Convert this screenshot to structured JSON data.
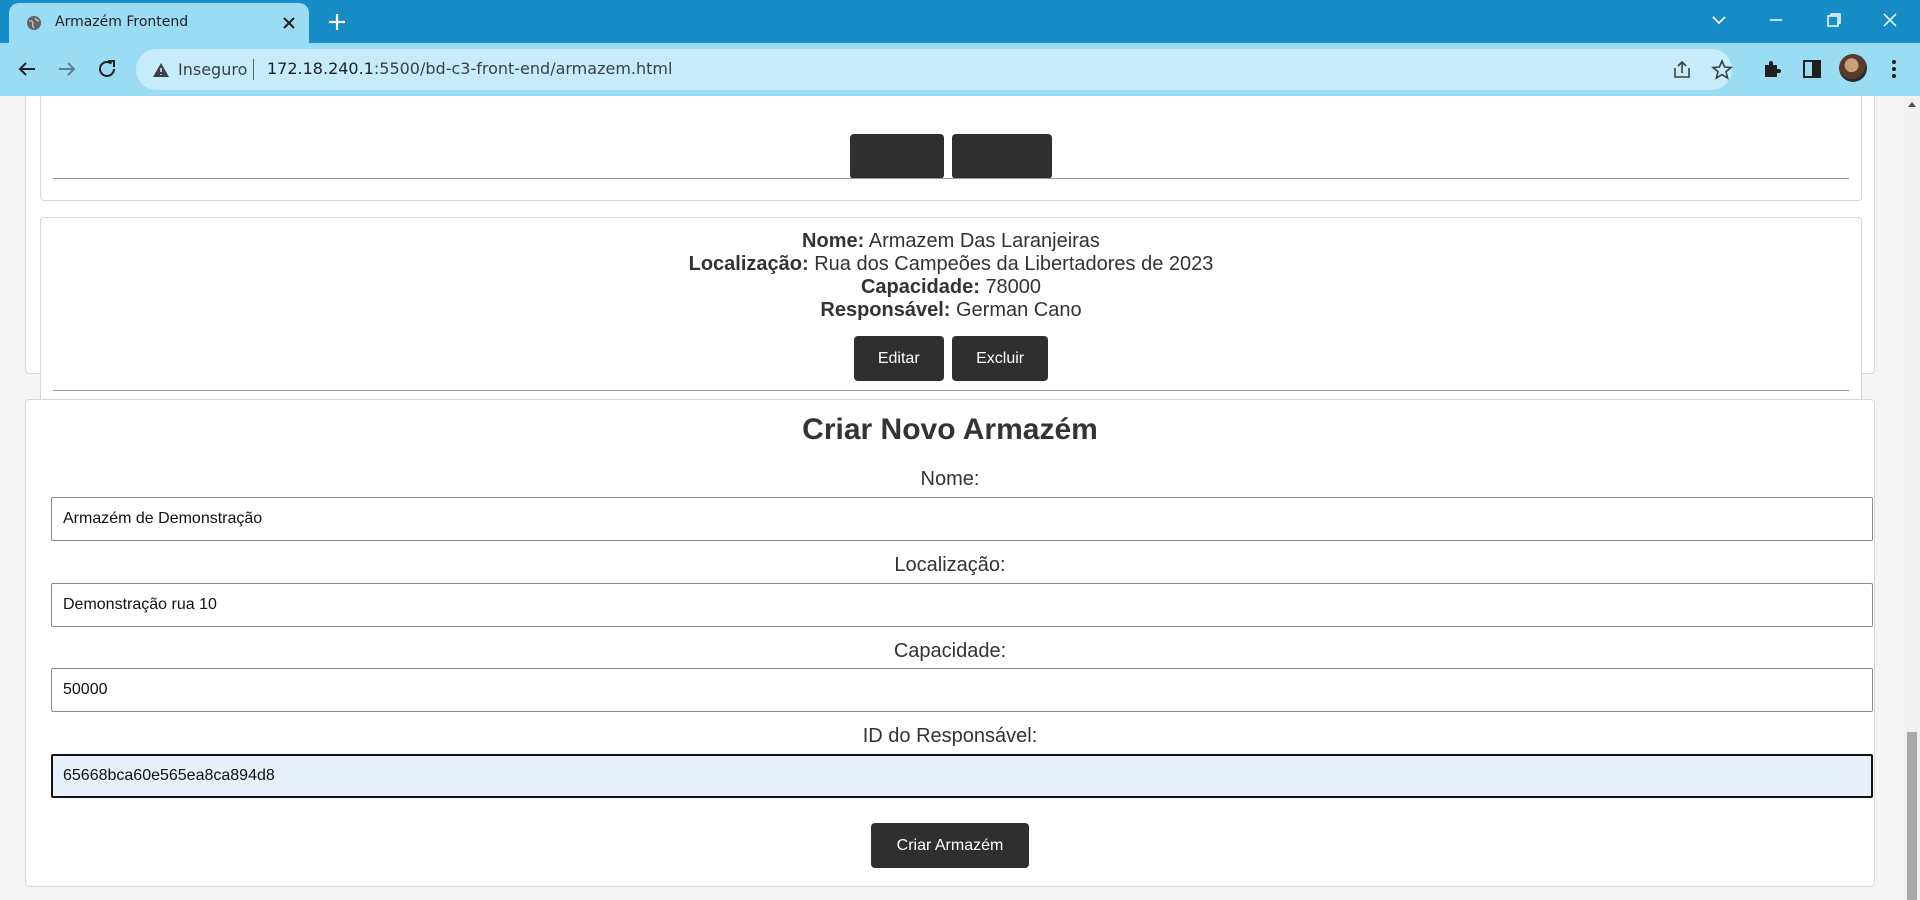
{
  "browser": {
    "tab_title": "Armazém Frontend",
    "security_label": "Inseguro",
    "url_host": "172.18.240.1",
    "url_path": ":5500/bd-c3-front-end/armazem.html"
  },
  "warehouses": [
    {
      "name_label": "Nome:",
      "name": "Armazem Das Laranjeiras",
      "location_label": "Localização:",
      "location": "Rua dos Campeões da Libertadores de 2023",
      "capacity_label": "Capacidade:",
      "capacity": "78000",
      "manager_label": "Responsável:",
      "manager": "German Cano",
      "edit_label": "Editar",
      "delete_label": "Excluir"
    }
  ],
  "form": {
    "title": "Criar Novo Armazém",
    "name_label": "Nome:",
    "name_value": "Armazém de Demonstração",
    "location_label": "Localização:",
    "location_value": "Demonstração rua 10",
    "capacity_label": "Capacidade:",
    "capacity_value": "50000",
    "manager_id_label": "ID do Responsável:",
    "manager_id_value": "65668bca60e565ea8ca894d8",
    "submit_label": "Criar Armazém"
  },
  "colors": {
    "tabbar": "#168dc7",
    "toolbar": "#9bdcf5",
    "button": "#2f2f2f",
    "focused_input": "#e8f0fe"
  }
}
